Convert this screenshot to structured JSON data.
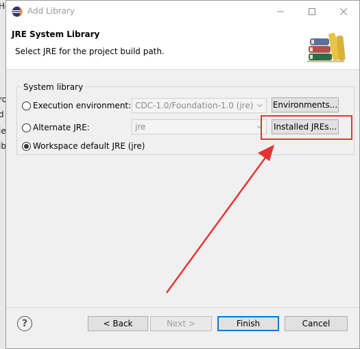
{
  "window": {
    "title": "Add Library",
    "controls": [
      "minimize",
      "maximize",
      "close"
    ]
  },
  "header": {
    "title": "JRE System Library",
    "subtitle": "Select JRE for the project build path."
  },
  "group": {
    "label": "System library",
    "options": [
      {
        "label": "Execution environment:",
        "selected": false,
        "combo_value": "CDC-1.0/Foundation-1.0 (jre)",
        "button": "Environments..."
      },
      {
        "label": "Alternate JRE:",
        "selected": false,
        "combo_value": "jre",
        "button": "Installed JREs..."
      },
      {
        "label": "Workspace default JRE (jre)",
        "selected": true
      }
    ]
  },
  "footer": {
    "back": "< Back",
    "next": "Next >",
    "finish": "Finish",
    "cancel": "Cancel"
  },
  "background_glyphs": [
    "He",
    "ro",
    "d",
    "ie",
    "ib"
  ],
  "colors": {
    "highlight": "#e53333",
    "primary_border": "#0078d7"
  }
}
